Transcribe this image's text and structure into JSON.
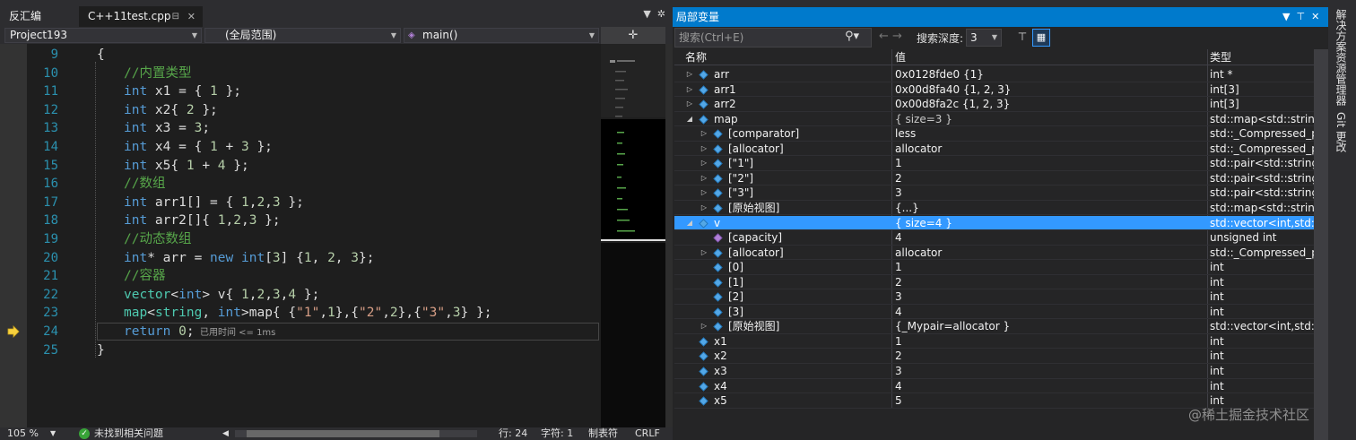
{
  "editor": {
    "tabs": {
      "disasm": "反汇编",
      "cpp": "C++11test.cpp"
    },
    "nav": {
      "project": "Project193",
      "scope": "(全局范围)",
      "func": "main()"
    },
    "lines": [
      {
        "n": "9",
        "code": "{"
      },
      {
        "n": "10",
        "code": "//内置类型"
      },
      {
        "n": "11",
        "code": "int x1 = { 1 };"
      },
      {
        "n": "12",
        "code": "int x2{ 2 };"
      },
      {
        "n": "13",
        "code": "int x3 = 3;"
      },
      {
        "n": "14",
        "code": "int x4 = { 1 + 3 };"
      },
      {
        "n": "15",
        "code": "int x5{ 1 + 4 };"
      },
      {
        "n": "16",
        "code": "//数组"
      },
      {
        "n": "17",
        "code": "int arr1[] = { 1,2,3 };"
      },
      {
        "n": "18",
        "code": "int arr2[]{ 1,2,3 };"
      },
      {
        "n": "19",
        "code": "//动态数组"
      },
      {
        "n": "20",
        "code": "int* arr = new int[3] {1, 2, 3};"
      },
      {
        "n": "21",
        "code": "//容器"
      },
      {
        "n": "22",
        "code": "vector<int> v{ 1,2,3,4 };"
      },
      {
        "n": "23",
        "code": "map<string, int>map{ {\"1\",1},{\"2\",2},{\"3\",3} };"
      },
      {
        "n": "24",
        "code": "return 0;"
      },
      {
        "n": "25",
        "code": "}"
      }
    ],
    "perf_tip": "已用时间 <= 1ms",
    "status": {
      "zoom": "105 %",
      "issues": "未找到相关问题",
      "line": "行: 24",
      "col": "字符: 1",
      "tab": "制表符",
      "eol": "CRLF"
    }
  },
  "locals": {
    "title": "局部变量",
    "search_placeholder": "搜索(Ctrl+E)",
    "depth_label": "搜索深度:",
    "depth_value": "3",
    "headers": {
      "name": "名称",
      "value": "值",
      "type": "类型"
    },
    "rows": [
      {
        "name": "arr",
        "value": "0x0128fde0 {1}",
        "type": "int *",
        "level": 0,
        "exp": "right"
      },
      {
        "name": "arr1",
        "value": "0x00d8fa40 {1, 2, 3}",
        "type": "int[3]",
        "level": 0,
        "exp": "right"
      },
      {
        "name": "arr2",
        "value": "0x00d8fa2c {1, 2, 3}",
        "type": "int[3]",
        "level": 0,
        "exp": "right"
      },
      {
        "name": "map",
        "value": "{ size=3 }",
        "type": "std::map<std::string,...",
        "level": 0,
        "exp": "down",
        "gray": true
      },
      {
        "name": "[comparator]",
        "value": "less",
        "type": "std::_Compressed_p...",
        "level": 1,
        "exp": "right"
      },
      {
        "name": "[allocator]",
        "value": "allocator",
        "type": "std::_Compressed_p...",
        "level": 1,
        "exp": "right"
      },
      {
        "name": "[\"1\"]",
        "value": "1",
        "type": "std::pair<std::string ...",
        "level": 1,
        "exp": "right"
      },
      {
        "name": "[\"2\"]",
        "value": "2",
        "type": "std::pair<std::string ...",
        "level": 1,
        "exp": "right"
      },
      {
        "name": "[\"3\"]",
        "value": "3",
        "type": "std::pair<std::string ...",
        "level": 1,
        "exp": "right"
      },
      {
        "name": "[原始视图]",
        "value": "{...}",
        "type": "std::map<std::string,...",
        "level": 1,
        "exp": "right"
      },
      {
        "name": "v",
        "value": "{ size=4 }",
        "type": "std::vector<int,std::al...",
        "level": 0,
        "exp": "down",
        "sel": true
      },
      {
        "name": "[capacity]",
        "value": "4",
        "type": "unsigned int",
        "level": 1,
        "exp": "none",
        "purple": true
      },
      {
        "name": "[allocator]",
        "value": "allocator",
        "type": "std::_Compressed_p...",
        "level": 1,
        "exp": "right"
      },
      {
        "name": "[0]",
        "value": "1",
        "type": "int",
        "level": 1,
        "exp": "none"
      },
      {
        "name": "[1]",
        "value": "2",
        "type": "int",
        "level": 1,
        "exp": "none"
      },
      {
        "name": "[2]",
        "value": "3",
        "type": "int",
        "level": 1,
        "exp": "none"
      },
      {
        "name": "[3]",
        "value": "4",
        "type": "int",
        "level": 1,
        "exp": "none"
      },
      {
        "name": "[原始视图]",
        "value": "{_Mypair=allocator }",
        "type": "std::vector<int,std::al...",
        "level": 1,
        "exp": "right"
      },
      {
        "name": "x1",
        "value": "1",
        "type": "int",
        "level": 0,
        "exp": "none"
      },
      {
        "name": "x2",
        "value": "2",
        "type": "int",
        "level": 0,
        "exp": "none"
      },
      {
        "name": "x3",
        "value": "3",
        "type": "int",
        "level": 0,
        "exp": "none"
      },
      {
        "name": "x4",
        "value": "4",
        "type": "int",
        "level": 0,
        "exp": "none"
      },
      {
        "name": "x5",
        "value": "5",
        "type": "int",
        "level": 0,
        "exp": "none"
      }
    ]
  },
  "side": {
    "tab1": "解决方案资源管理器",
    "tab2": "Git 更改"
  },
  "watermark": "@稀土掘金技术社区",
  "colors": {
    "accent": "#007acc",
    "selection": "#3399ff",
    "keyword": "#569cd6",
    "comment": "#57a64a",
    "type": "#4ec9b0",
    "linenum": "#2b91af"
  }
}
